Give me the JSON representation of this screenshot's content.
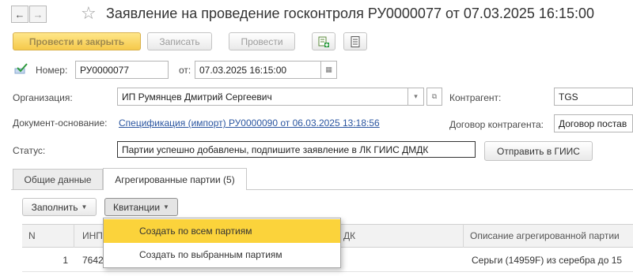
{
  "header": {
    "back_glyph": "←",
    "forward_glyph": "→",
    "star_glyph": "☆",
    "title": "Заявление на проведение госконтроля РУ0000077 от 07.03.2025 16:15:00"
  },
  "toolbar": {
    "post_close": "Провести и закрыть",
    "save": "Записать",
    "post": "Провести"
  },
  "form": {
    "number_label": "Номер:",
    "number_value": "РУ0000077",
    "date_label": "от:",
    "date_value": "07.03.2025 16:15:00",
    "org_label": "Организация:",
    "org_value": "ИП Румянцев Дмитрий Сергеевич",
    "contractor_label": "Контрагент:",
    "contractor_value": "TGS",
    "basis_label": "Документ-основание:",
    "basis_value": "Спецификация (импорт) РУ0000090 от 06.03.2025 13:18:56",
    "contract_label": "Договор контрагента:",
    "contract_value": "Договор постав",
    "status_label": "Статус:",
    "status_value": "Партии успешно добавлены, подпишите заявление в ЛК ГИИС ДМДК",
    "send_button": "Отправить в ГИИС"
  },
  "tabs": [
    {
      "label": "Общие данные",
      "active": false
    },
    {
      "label": "Агрегированные партии (5)",
      "active": true
    }
  ],
  "subtoolbar": {
    "fill": "Заполнить",
    "receipts": "Квитанции"
  },
  "table": {
    "columns": [
      "N",
      "ИНП",
      "ДК",
      "Описание агрегированной партии"
    ],
    "rows": [
      {
        "n": "1",
        "inp": "7642",
        "dk": "",
        "description": "Серьги (14959F) из серебра до 15"
      }
    ]
  },
  "menu": {
    "items": [
      {
        "label": "Создать по всем партиям",
        "highlighted": true
      },
      {
        "label": "Создать по выбранным партиям",
        "highlighted": false
      }
    ]
  },
  "colors": {
    "accent_yellow": "#fbd33b",
    "link_blue": "#2a55a0"
  }
}
